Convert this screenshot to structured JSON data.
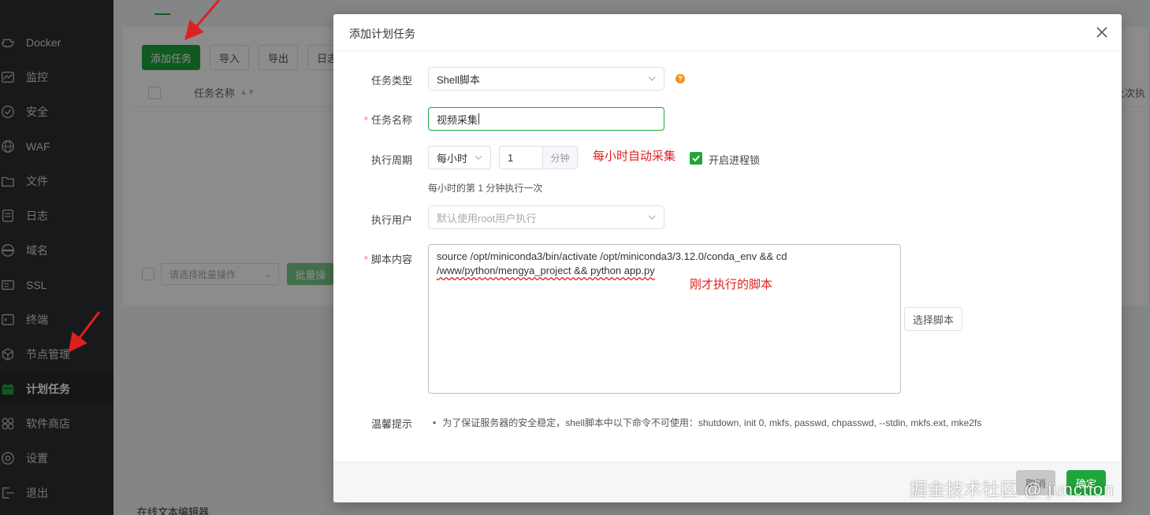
{
  "sidebar": {
    "items": [
      {
        "label": "Docker",
        "icon": "docker-icon"
      },
      {
        "label": "监控",
        "icon": "monitor-icon"
      },
      {
        "label": "安全",
        "icon": "shield-icon"
      },
      {
        "label": "WAF",
        "icon": "globe-icon"
      },
      {
        "label": "文件",
        "icon": "folder-icon"
      },
      {
        "label": "日志",
        "icon": "log-icon"
      },
      {
        "label": "域名",
        "icon": "www-icon"
      },
      {
        "label": "SSL",
        "icon": "ssl-icon"
      },
      {
        "label": "终端",
        "icon": "terminal-icon"
      },
      {
        "label": "节点管理",
        "icon": "cube-icon"
      },
      {
        "label": "计划任务",
        "icon": "calendar-icon",
        "active": true
      },
      {
        "label": "软件商店",
        "icon": "apps-icon"
      },
      {
        "label": "设置",
        "icon": "gear-icon"
      },
      {
        "label": "退出",
        "icon": "logout-icon"
      }
    ]
  },
  "background": {
    "add_task": "添加任务",
    "import": "导入",
    "export": "导出",
    "log_partial": "日志",
    "col_task_name": "任务名称",
    "col_last_partial": "上次执",
    "batch_placeholder": "请选择批量操作",
    "batch_button_partial": "批量操",
    "editor_label": "在线文本编辑器"
  },
  "dialog": {
    "title": "添加计划任务",
    "task_type_label": "任务类型",
    "task_type_value": "Shell脚本",
    "task_name_label": "任务名称",
    "task_name_value": "视频采集",
    "period_label": "执行周期",
    "period_value": "每小时",
    "minute_value": "1",
    "minute_unit": "分钟",
    "period_note": "每小时自动采集",
    "process_lock_label": "开启进程锁",
    "process_lock_checked": true,
    "period_desc": "每小时的第 1 分钟执行一次",
    "user_label": "执行用户",
    "user_placeholder": "默认使用root用户执行",
    "script_label": "脚本内容",
    "script_line1": "source /opt/miniconda3/bin/activate /opt/miniconda3/3.12.0/conda_env && cd",
    "script_line2": "/www/python/mengya_project && python app.py",
    "script_note": "刚才执行的脚本",
    "choose_script": "选择脚本",
    "tips_label": "温馨提示",
    "tips_text": "为了保证服务器的安全稳定，shell脚本中以下命令不可使用：shutdown, init 0, mkfs, passwd, chpasswd, --stdin, mkfs.ext, mke2fs",
    "cancel": "取消",
    "confirm": "确定"
  },
  "colors": {
    "brand_green": "#20a53a",
    "sidebar_bg": "#2b2e31",
    "annotation_red": "#e02020",
    "hint_orange": "#f0941d"
  },
  "watermark": "掘金技术社区 @ junction"
}
